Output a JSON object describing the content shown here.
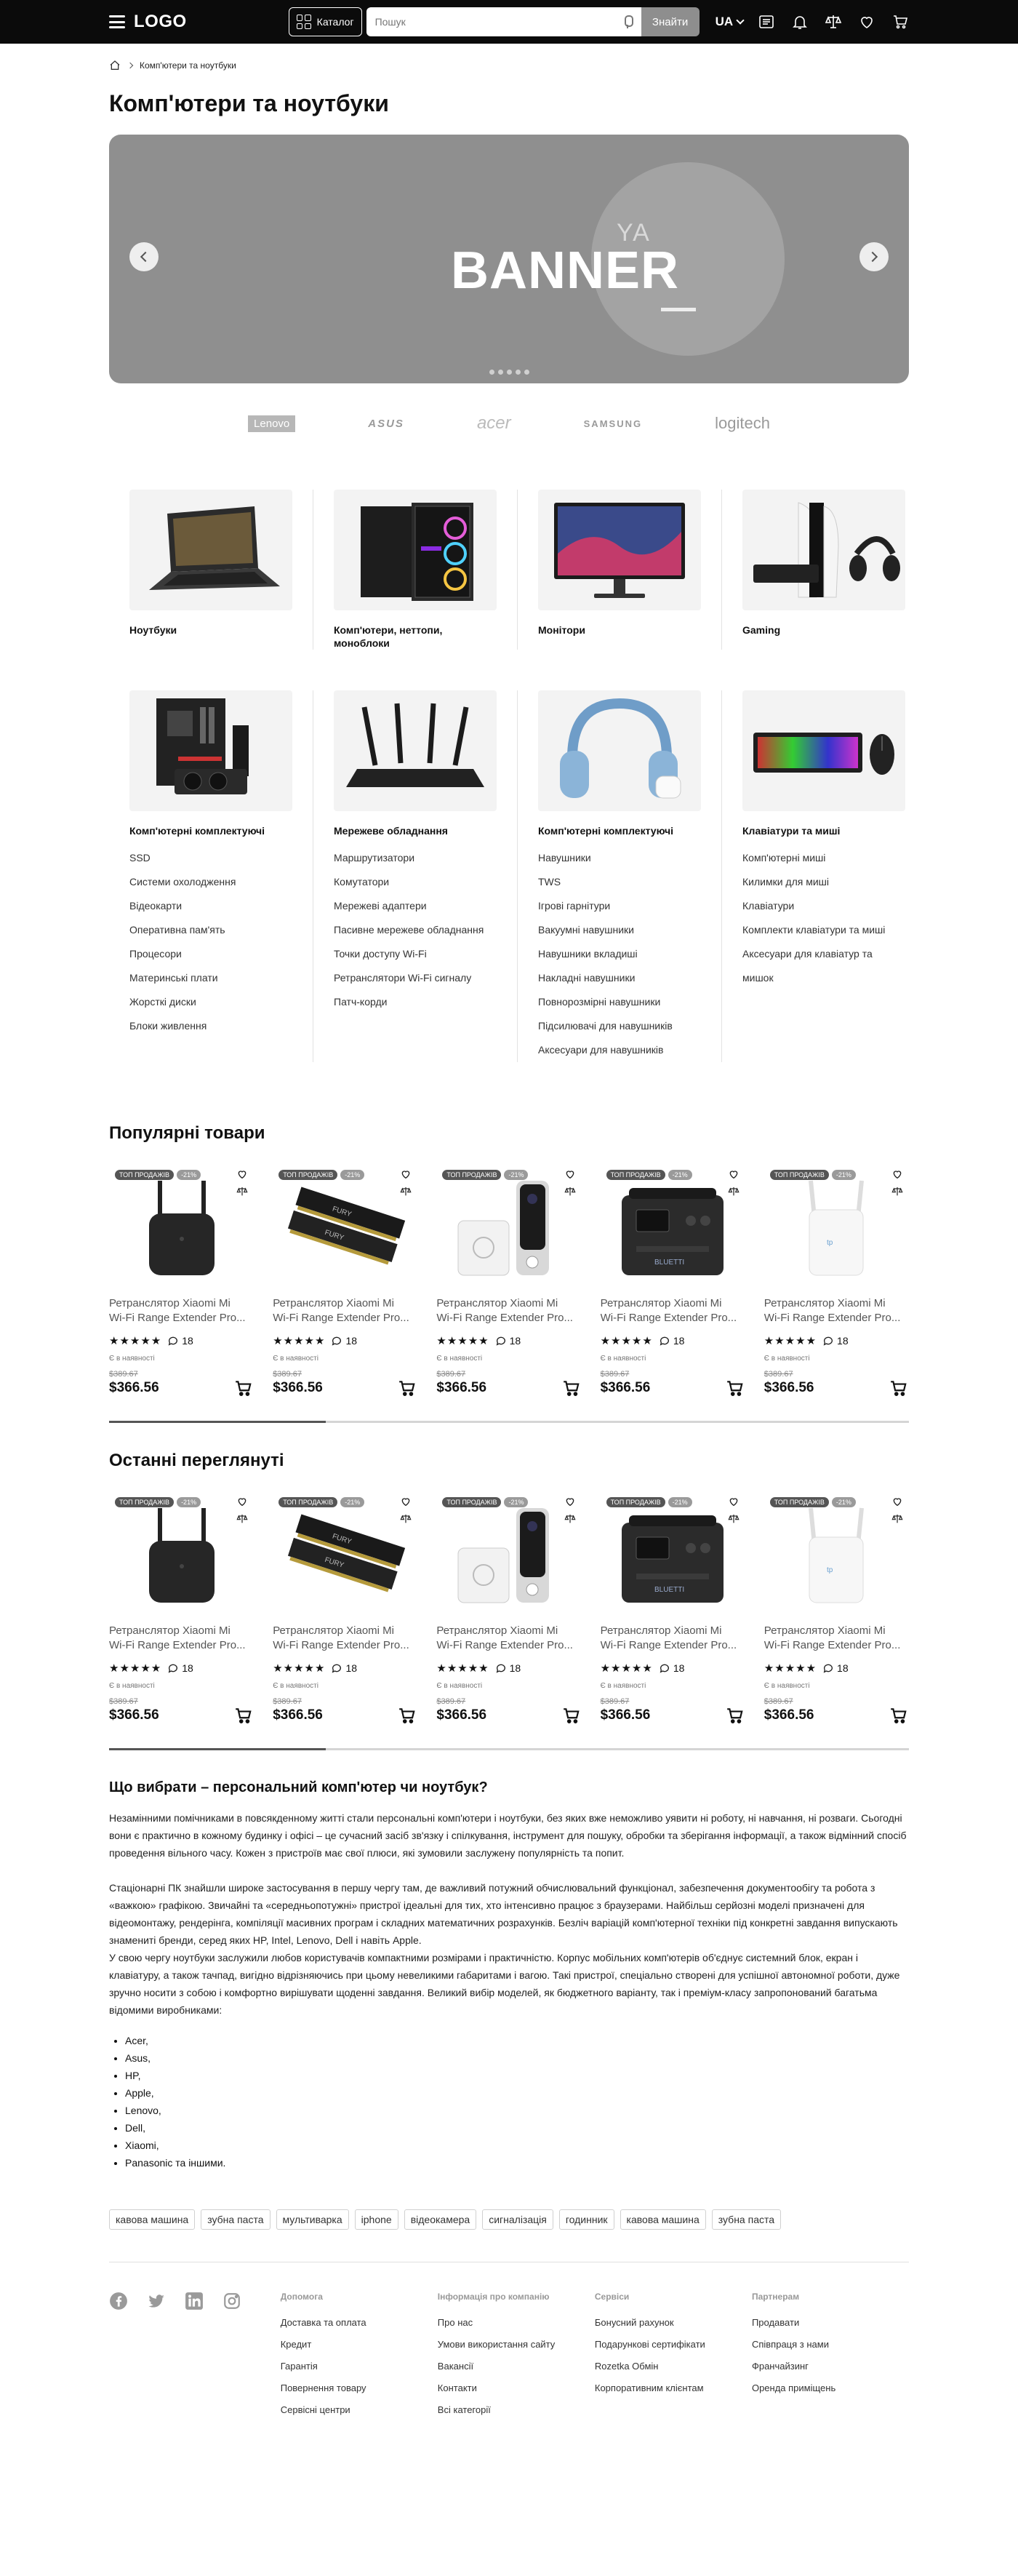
{
  "header": {
    "logo": "LOGO",
    "catalog_label": "Каталог",
    "search_placeholder": "Пошук",
    "search_button": "Знайти",
    "language": "UA"
  },
  "breadcrumb": {
    "current": "Комп'ютери та ноутбуки"
  },
  "page_title": "Комп'ютери та ноутбуки",
  "banner": {
    "small_text": "YA",
    "big_text": "BANNER"
  },
  "brands": [
    "Lenovo",
    "ASUS",
    "acer",
    "SAMSUNG",
    "logitech"
  ],
  "categories": [
    {
      "title": "Ноутбуки",
      "items": []
    },
    {
      "title": "Комп'ютери, неттопи, моноблоки",
      "items": []
    },
    {
      "title": "Монітори",
      "items": []
    },
    {
      "title": "Gaming",
      "items": []
    },
    {
      "title": "Комп'ютерні комплектуючі",
      "items": [
        "SSD",
        "Системи охолодження",
        "Відеокарти",
        "Оперативна пам'ять",
        "Процесори",
        "Материнські плати",
        "Жорсткі диски",
        "Блоки живлення"
      ]
    },
    {
      "title": "Мережеве обладнання",
      "items": [
        "Маршрутизатори",
        "Комутатори",
        "Мережеві адаптери",
        "Пасивне мережеве обладнання",
        "Точки доступу Wi-Fi",
        "Ретранслятори Wi-Fi сигналу",
        "Патч-корди"
      ]
    },
    {
      "title": "Комп'ютерні комплектуючі",
      "items": [
        "Навушники",
        "TWS",
        "Ігрові гарнітури",
        "Вакуумні навушники",
        "Навушники вкладиші",
        "Накладні навушники",
        "Повнорозмірні навушники",
        "Підсилювачі для навушників",
        "Аксесуари для навушників"
      ]
    },
    {
      "title": "Клавіатури та миші",
      "items": [
        "Комп'ютерні миші",
        "Килимки для миші",
        "Клавіатури",
        "Комплекти клавіатури та миші",
        "Аксесуари для клавіатур та мишок"
      ]
    }
  ],
  "popular": {
    "title": "Популярні товари",
    "products": [
      {
        "badge": "ТОП ПРОДАЖІВ",
        "discount": "-21%",
        "image": "wifi-extender-black",
        "name_l1": "Ретранслятор Xiaomi Mi",
        "name_l2": "Wi-Fi Range Extender Pro...",
        "stars": "★★★★★",
        "reviews": "18",
        "stock": "Є в наявності",
        "old_price": "$389.67",
        "price": "$366.56"
      },
      {
        "badge": "ТОП ПРОДАЖІВ",
        "discount": "-21%",
        "image": "ram-modules",
        "name_l1": "Ретранслятор Xiaomi Mi",
        "name_l2": "Wi-Fi Range Extender Pro...",
        "stars": "★★★★★",
        "reviews": "18",
        "stock": "Є в наявності",
        "old_price": "$389.67",
        "price": "$366.56"
      },
      {
        "badge": "ТОП ПРОДАЖІВ",
        "discount": "-21%",
        "image": "video-doorbell",
        "name_l1": "Ретранслятор Xiaomi Mi",
        "name_l2": "Wi-Fi Range Extender Pro...",
        "stars": "★★★★★",
        "reviews": "18",
        "stock": "Є в наявності",
        "old_price": "$389.67",
        "price": "$366.56"
      },
      {
        "badge": "ТОП ПРОДАЖІВ",
        "discount": "-21%",
        "image": "power-station",
        "name_l1": "Ретранслятор Xiaomi Mi",
        "name_l2": "Wi-Fi Range Extender Pro...",
        "stars": "★★★★★",
        "reviews": "18",
        "stock": "Є в наявності",
        "old_price": "$389.67",
        "price": "$366.56"
      },
      {
        "badge": "ТОП ПРОДАЖІВ",
        "discount": "-21%",
        "image": "wifi-extender-white",
        "name_l1": "Ретранслятор Xiaomi Mi",
        "name_l2": "Wi-Fi Range Extender Pro...",
        "stars": "★★★★★",
        "reviews": "18",
        "stock": "Є в наявності",
        "old_price": "$389.67",
        "price": "$366.56"
      }
    ]
  },
  "recent": {
    "title": "Останні переглянуті",
    "products": [
      {
        "badge": "ТОП ПРОДАЖІВ",
        "discount": "-21%",
        "image": "wifi-extender-black",
        "name_l1": "Ретранслятор Xiaomi Mi",
        "name_l2": "Wi-Fi Range Extender Pro...",
        "stars": "★★★★★",
        "reviews": "18",
        "stock": "Є в наявності",
        "old_price": "$389.67",
        "price": "$366.56"
      },
      {
        "badge": "ТОП ПРОДАЖІВ",
        "discount": "-21%",
        "image": "ram-modules",
        "name_l1": "Ретранслятор Xiaomi Mi",
        "name_l2": "Wi-Fi Range Extender Pro...",
        "stars": "★★★★★",
        "reviews": "18",
        "stock": "Є в наявності",
        "old_price": "$389.67",
        "price": "$366.56"
      },
      {
        "badge": "ТОП ПРОДАЖІВ",
        "discount": "-21%",
        "image": "video-doorbell",
        "name_l1": "Ретранслятор Xiaomi Mi",
        "name_l2": "Wi-Fi Range Extender Pro...",
        "stars": "★★★★★",
        "reviews": "18",
        "stock": "Є в наявності",
        "old_price": "$389.67",
        "price": "$366.56"
      },
      {
        "badge": "ТОП ПРОДАЖІВ",
        "discount": "-21%",
        "image": "power-station",
        "name_l1": "Ретранслятор Xiaomi Mi",
        "name_l2": "Wi-Fi Range Extender Pro...",
        "stars": "★★★★★",
        "reviews": "18",
        "stock": "Є в наявності",
        "old_price": "$389.67",
        "price": "$366.56"
      },
      {
        "badge": "ТОП ПРОДАЖІВ",
        "discount": "-21%",
        "image": "wifi-extender-white",
        "name_l1": "Ретранслятор Xiaomi Mi",
        "name_l2": "Wi-Fi Range Extender Pro...",
        "stars": "★★★★★",
        "reviews": "18",
        "stock": "Є в наявності",
        "old_price": "$389.67",
        "price": "$366.56"
      }
    ]
  },
  "article": {
    "title": "Що вибрати – персональний комп'ютер чи ноутбук?",
    "p1": "Незамінними помічниками в повсякденному житті стали персональні комп'ютери і ноутбуки, без яких вже неможливо уявити ні роботу, ні навчання, ні розваги. Сьогодні вони є практично в кожному будинку і офісі – це сучасний засіб зв'язку і спілкування, інструмент для пошуку, обробки та зберігання інформації, а також відмінний спосіб проведення вільного часу. Кожен з пристроїв має свої плюси, які зумовили заслужену популярність та попит.",
    "p2": "Стаціонарні ПК знайшли широке застосування в першу чергу там, де важливий потужний обчислювальний функціонал, забезпечення документообігу та робота з «важкою» графікою. Звичайні та «середньопотужні» пристрої ідеальні для тих, хто інтенсивно працює з браузерами. Найбільш серйозні моделі призначені для відеомонтажу, рендерінга, компіляції масивних програм і складних математичних розрахунків. Безліч варіацій комп'ютерної техніки під конкретні завдання випускають знамениті бренди, серед яких HP, Intel, Lenovo, Dell і навіть Apple.",
    "p3": "У свою чергу ноутбуки заслужили любов користувачів компактними розмірами і практичністю. Корпус мобільних комп'ютерів об'єднує системний блок, екран і клавіатуру, а також тачпад, вигідно відрізняючись при цьому невеликими габаритами і вагою. Такі пристрої, спеціально створені для успішної автономної роботи, дуже зручно носити з собою і комфортно вирішувати щоденні завдання. Великий вибір моделей, як бюджетного варіанту, так і преміум-класу запропонований багатьма відомими виробниками:",
    "list": [
      "Acer,",
      "Asus,",
      "HP,",
      "Apple,",
      "Lenovo,",
      "Dell,",
      "Xiaomi,",
      "Panasonic та іншими."
    ]
  },
  "tags": [
    "кавова машина",
    "зубна паста",
    "мультиварка",
    "iphone",
    "відеокамера",
    "сигналізація",
    "годинник",
    "кавова машина",
    "зубна паста"
  ],
  "footer": {
    "socials": [
      "facebook-icon",
      "twitter-icon",
      "linkedin-icon",
      "instagram-icon"
    ],
    "columns": [
      {
        "heading": "Допомога",
        "links": [
          "Доставка та оплата",
          "Кредит",
          "Гарантія",
          "Повернення товару",
          "Сервісні центри"
        ]
      },
      {
        "heading": "Інформація про компанію",
        "links": [
          "Про нас",
          "Умови використання сайту",
          "Вакансії",
          "Контакти",
          "Всі категорії"
        ]
      },
      {
        "heading": "Сервіси",
        "links": [
          "Бонусний рахунок",
          "Подарункові сертифікати",
          "Rozetka Обмін",
          "Корпоративним клієнтам"
        ]
      },
      {
        "heading": "Партнерам",
        "links": [
          "Продавати",
          "Співпраця з нами",
          "Франчайзинг",
          "Оренда приміщень"
        ]
      }
    ]
  },
  "colors": {
    "header_bg": "#0b0b0b",
    "banner_bg": "#8f8f8f",
    "search_button": "#8e8e8e",
    "badge": "#555555"
  }
}
